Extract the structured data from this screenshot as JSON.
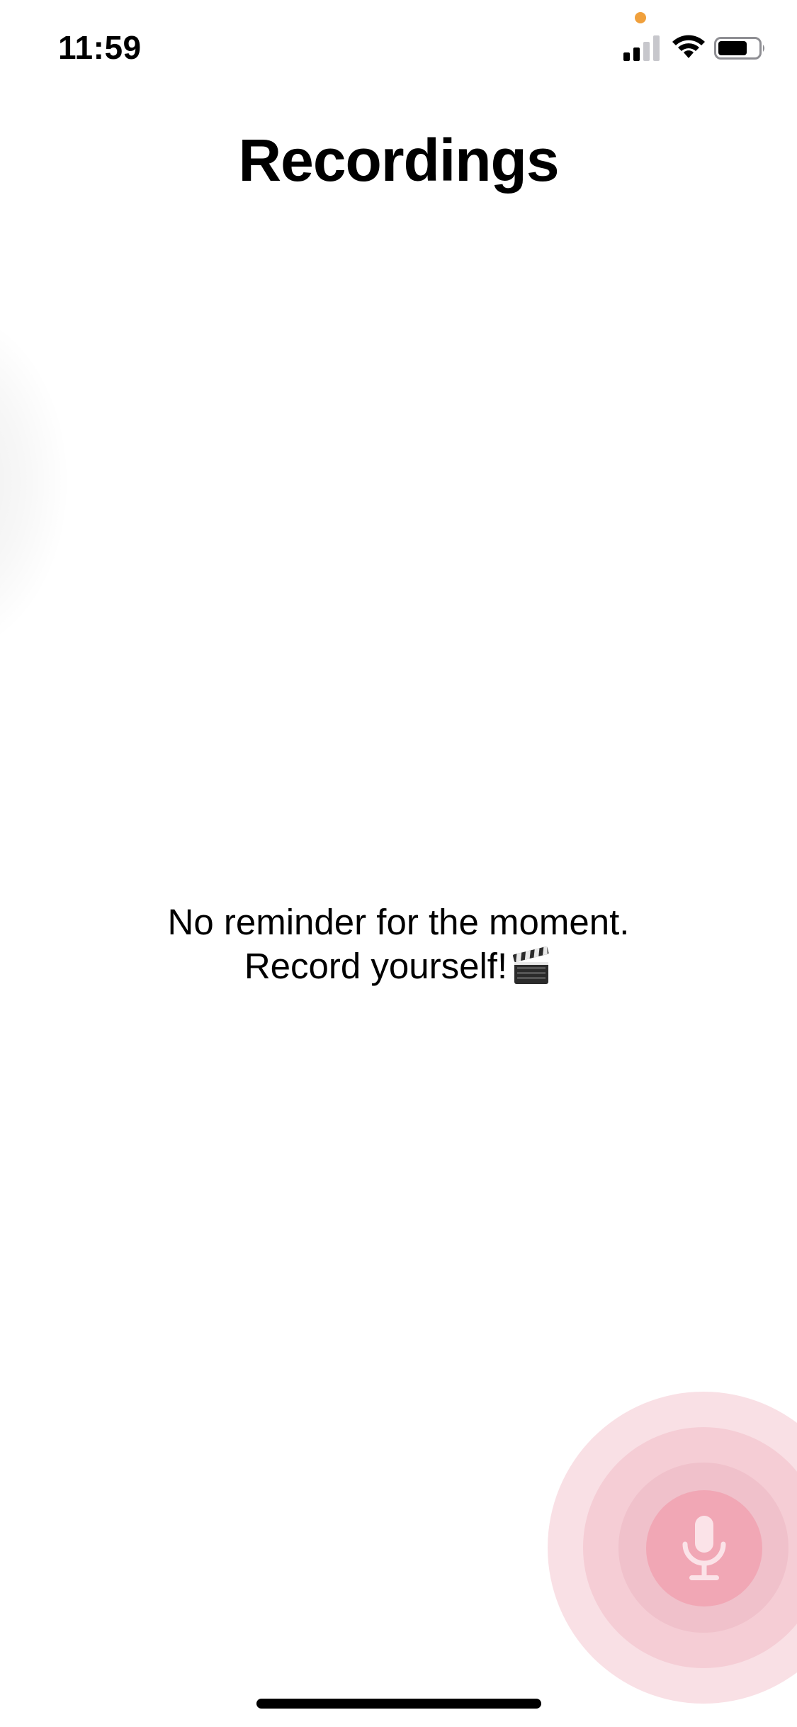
{
  "status_bar": {
    "time": "11:59",
    "privacy_dot_color": "#f0a03c",
    "icons": [
      "cellular-signal-icon",
      "wifi-icon",
      "battery-icon"
    ]
  },
  "header": {
    "title": "Recordings"
  },
  "empty_state": {
    "line1": "No reminder for the moment.",
    "line2": "Record yourself!",
    "icon": "clapper-board-icon"
  },
  "record_button": {
    "icon": "microphone-icon",
    "color": "#f1a7b5"
  },
  "colors": {
    "background": "#ffffff",
    "accent_pink": "#f1a7b5"
  }
}
